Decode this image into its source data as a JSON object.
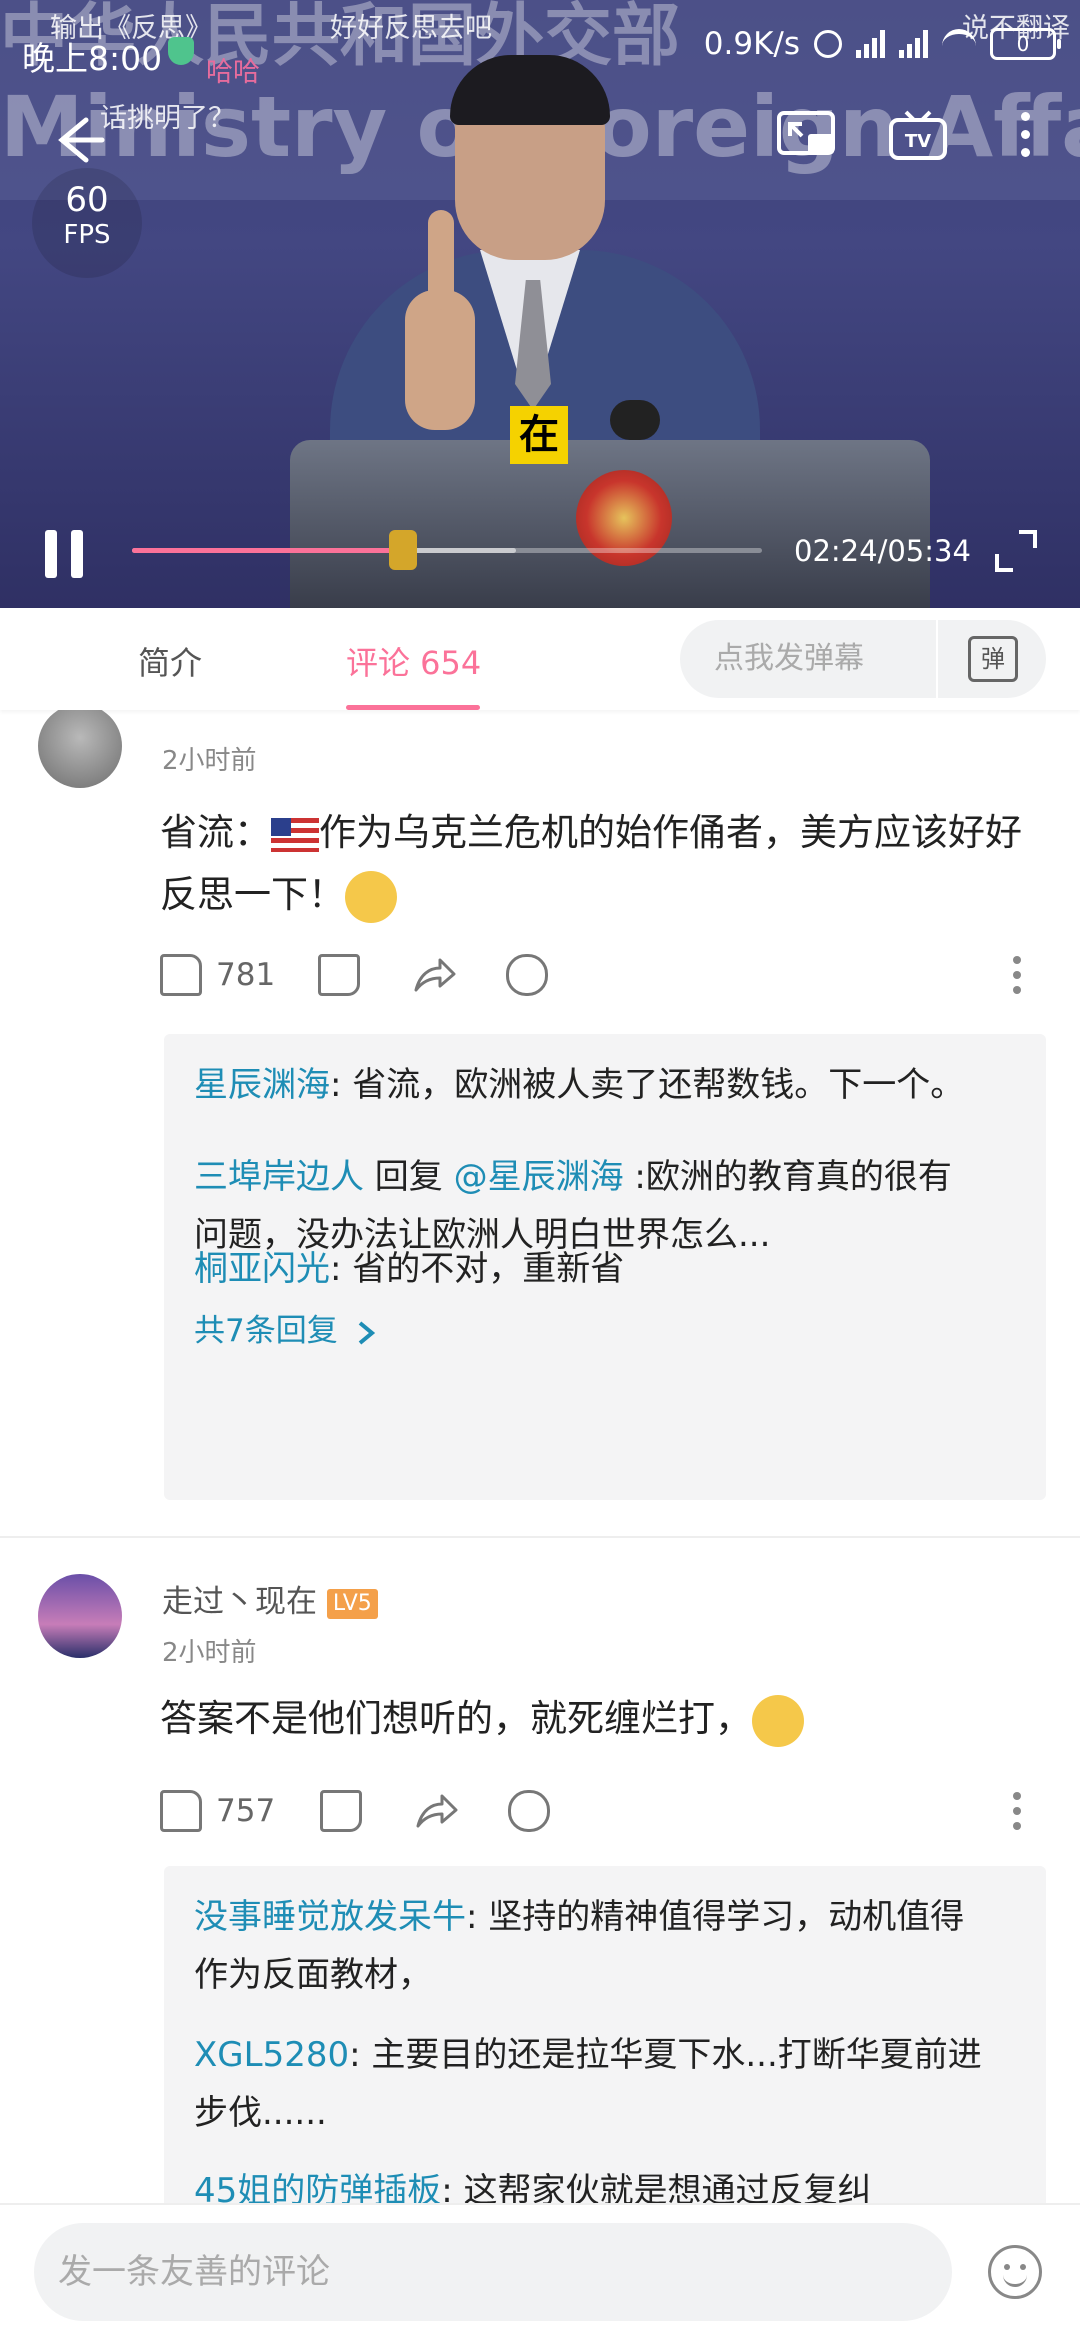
{
  "status_bar": {
    "time": "晚上8:00",
    "net_speed": "0.9K/s",
    "battery": "0"
  },
  "video": {
    "banner_line1": "中华人民共和国外交部",
    "banner_line2": "Ministry of Foreign Affairs",
    "fps_value": "60",
    "fps_unit": "FPS",
    "subtitle": "在",
    "time_display": "02:24/05:34",
    "progress": 0.43,
    "buffered": 0.61,
    "danmaku": [
      "输出《反思》",
      "好好反思去吧",
      "说不翻译",
      "话挑明了？",
      "哈哈"
    ]
  },
  "tabs": {
    "intro": "简介",
    "comments": "评论 654",
    "danmaku_placeholder": "点我发弹幕",
    "danmaku_icon": "弹"
  },
  "comments": [
    {
      "username": "",
      "time": "2小时前",
      "text_prefix": "省流：",
      "text": "作为乌克兰危机的始作俑者，美方应该好好反思一下！",
      "likes": "781",
      "replies": [
        {
          "user": "星辰渊海",
          "text": ": 省流，欧洲被人卖了还帮数钱。下一个。"
        },
        {
          "user": "三埠岸边人",
          "reply_word": " 回复 ",
          "mention": "@星辰渊海",
          "text": " :欧洲的教育真的很有问题，没办法让欧洲人明白世界怎么..."
        },
        {
          "user": "桐亚闪光",
          "text": ": 省的不对，重新省"
        }
      ],
      "more_replies": "共7条回复"
    },
    {
      "username": "走过丶现在",
      "level": "LV5",
      "time": "2小时前",
      "text": "答案不是他们想听的，就死缠烂打，",
      "likes": "757",
      "replies": [
        {
          "user": "没事睡觉放发呆牛",
          "text": ": 坚持的精神值得学习，动机值得作为反面教材，"
        },
        {
          "user": "XGL5280",
          "text": ": 主要目的还是拉华夏下水...打断华夏前进步伐......"
        },
        {
          "user": "45姐的防弹插板",
          "text": ": 这帮家伙就是想通过反复纠"
        }
      ]
    }
  ],
  "bottom": {
    "comment_placeholder": "发一条友善的评论"
  },
  "colors": {
    "accent": "#fb7299",
    "link": "#1e8db5"
  }
}
